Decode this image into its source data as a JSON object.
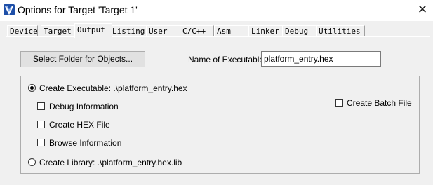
{
  "window": {
    "title": "Options for Target 'Target 1'",
    "close_glyph": "✕",
    "icon": "uvision-app-icon"
  },
  "tabs": [
    {
      "label": "Device",
      "active": false
    },
    {
      "label": "Target",
      "active": false
    },
    {
      "label": "Output",
      "active": true
    },
    {
      "label": "Listing",
      "active": false
    },
    {
      "label": "User",
      "active": false
    },
    {
      "label": "C/C++",
      "active": false
    },
    {
      "label": "Asm",
      "active": false
    },
    {
      "label": "Linker",
      "active": false
    },
    {
      "label": "Debug",
      "active": false
    },
    {
      "label": "Utilities",
      "active": false
    }
  ],
  "output": {
    "select_folder_label": "Select Folder for Objects...",
    "name_label": "Name of Executable:",
    "name_value": "platform_entry.hex",
    "create_executable_label": "Create Executable:  .\\platform_entry.hex",
    "create_executable_selected": true,
    "debug_information_label": "Debug Information",
    "debug_information_checked": false,
    "create_hex_label": "Create HEX File",
    "create_hex_checked": false,
    "browse_information_label": "Browse Information",
    "browse_information_checked": false,
    "create_batch_label": "Create Batch File",
    "create_batch_checked": false,
    "create_library_label": "Create Library:  .\\platform_entry.hex.lib",
    "create_library_selected": false
  }
}
